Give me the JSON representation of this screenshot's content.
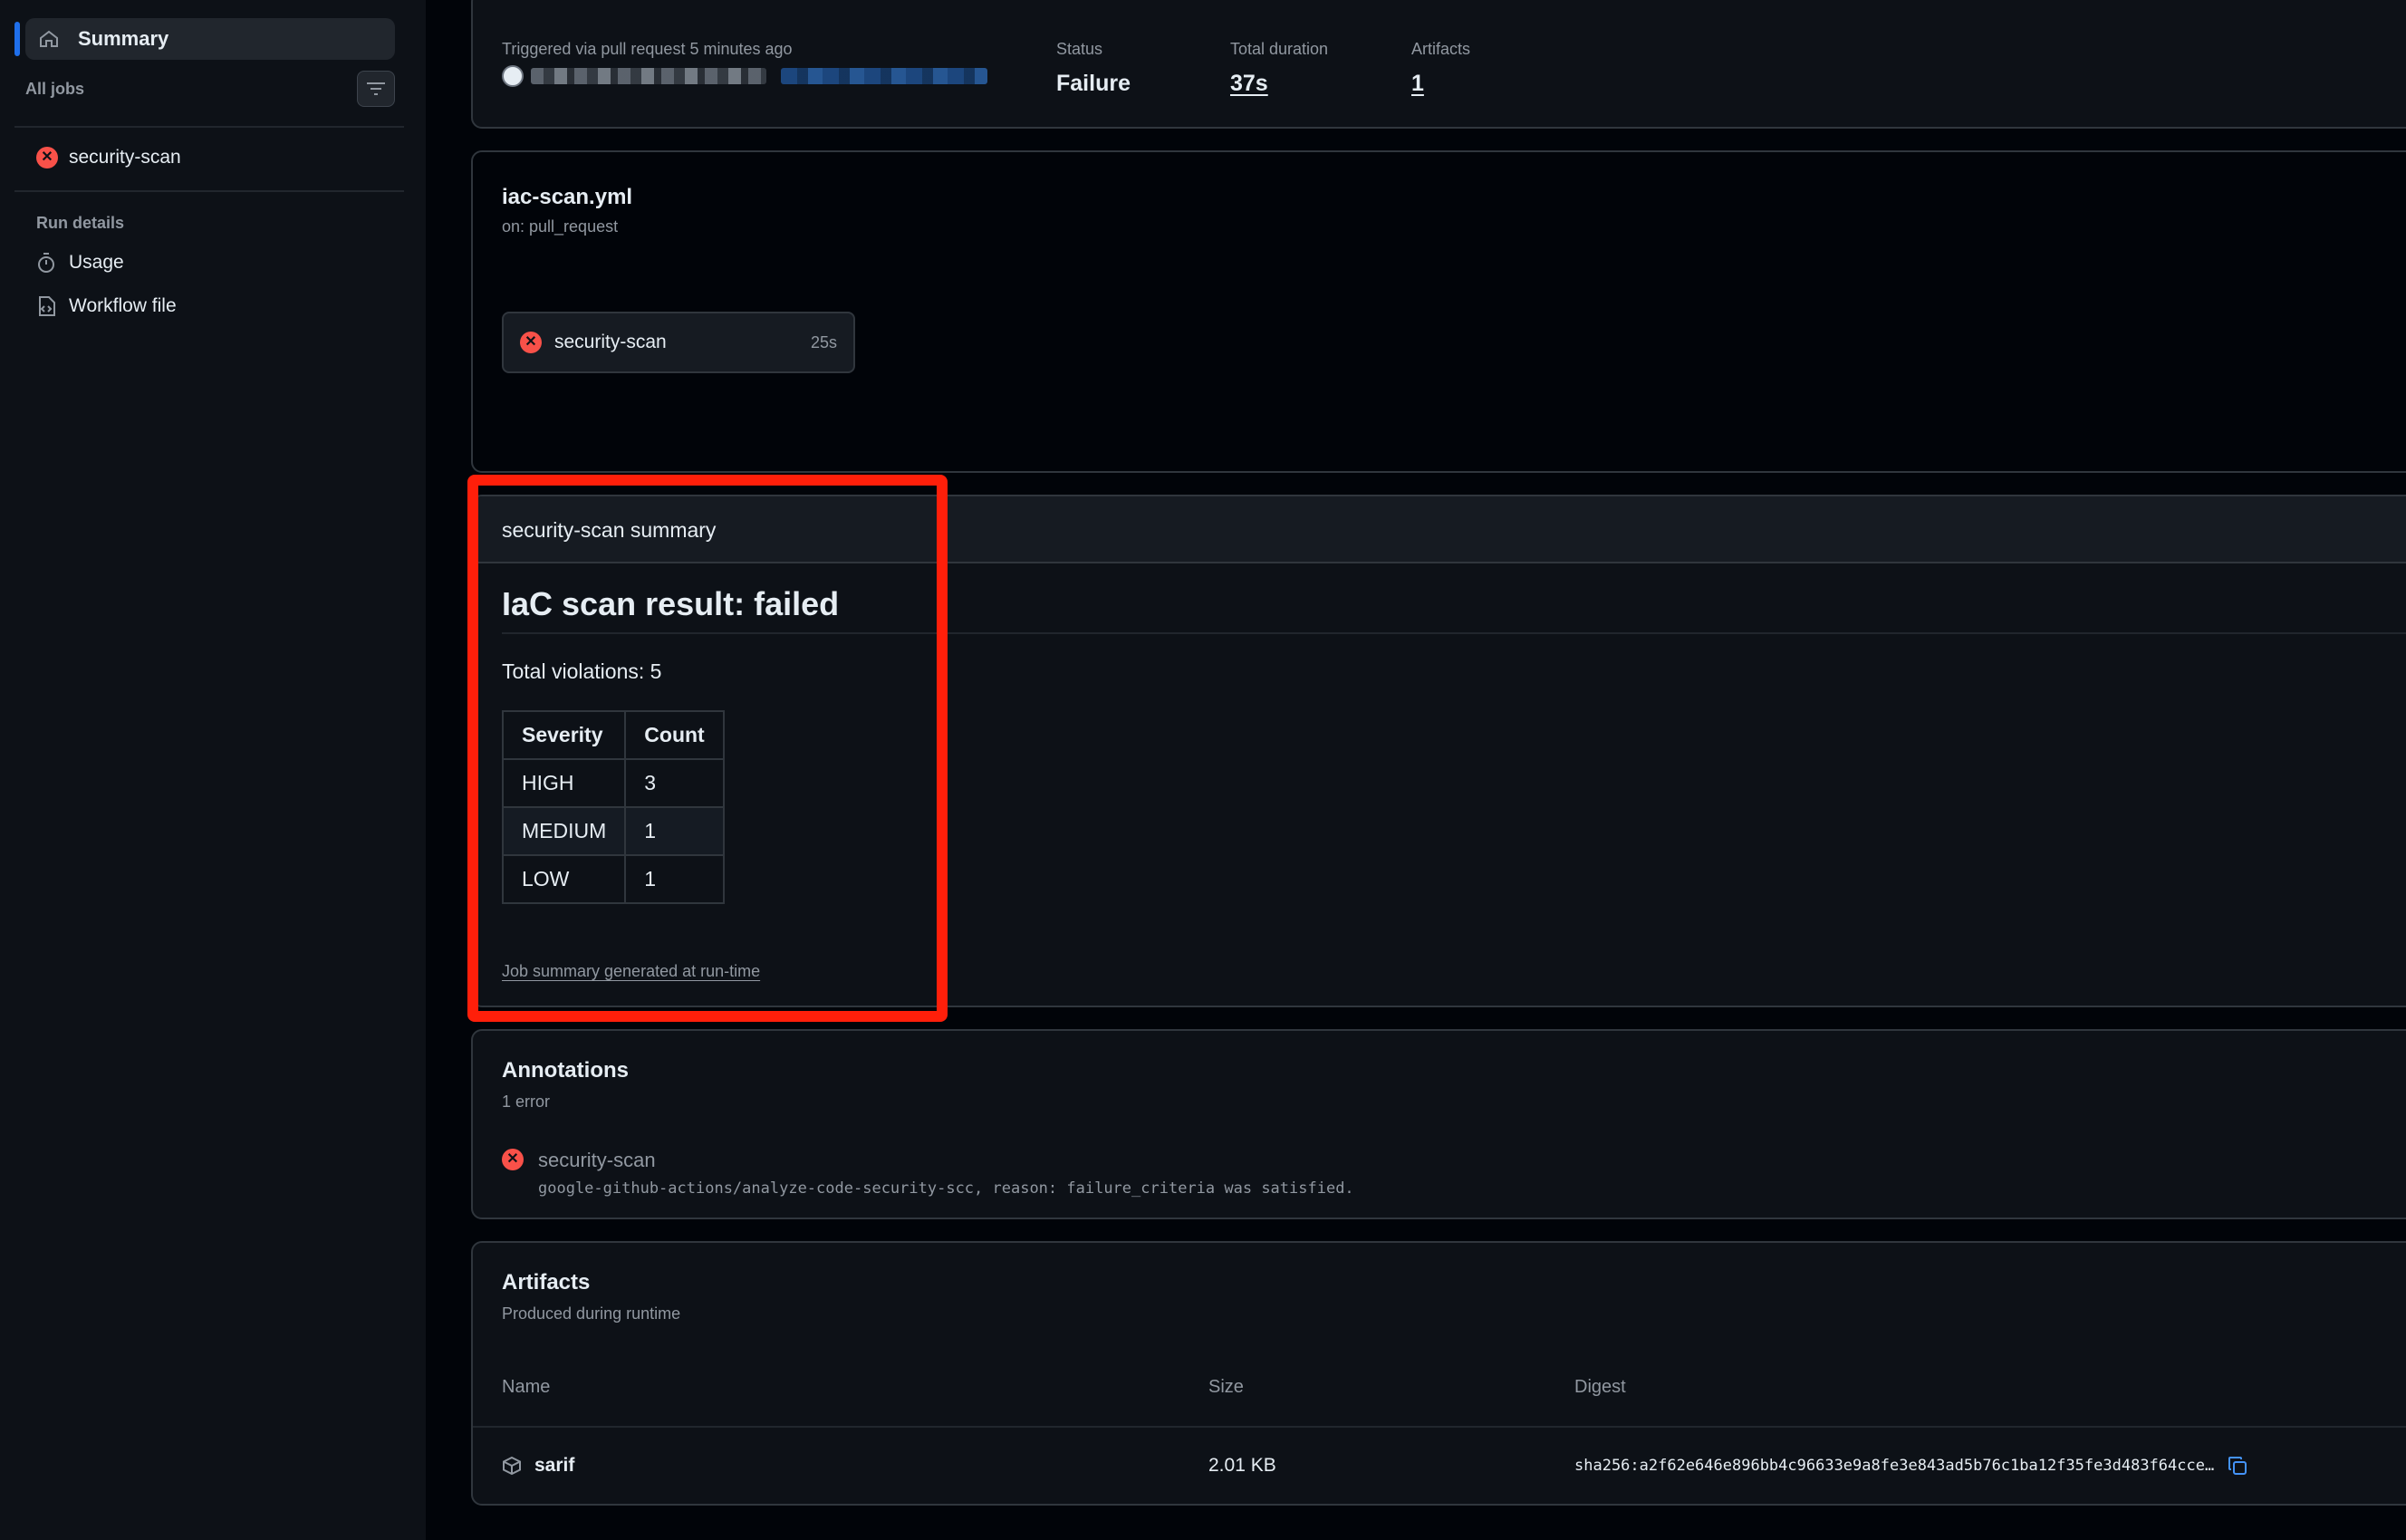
{
  "sidebar": {
    "summary_label": "Summary",
    "all_jobs_label": "All jobs",
    "jobs": [
      {
        "name": "security-scan",
        "status": "failure"
      }
    ],
    "run_details_label": "Run details",
    "links": [
      {
        "label": "Usage",
        "icon": "stopwatch-icon"
      },
      {
        "label": "Workflow file",
        "icon": "file-code-icon"
      }
    ]
  },
  "trigger": {
    "label": "Triggered via pull request 5 minutes ago",
    "status_label": "Status",
    "status_value": "Failure",
    "duration_label": "Total duration",
    "duration_value": "37s",
    "artifacts_label": "Artifacts",
    "artifacts_value": "1"
  },
  "workflow": {
    "file": "iac-scan.yml",
    "event": "on: pull_request",
    "job_name": "security-scan",
    "job_duration": "25s"
  },
  "job_summary": {
    "header": "security-scan summary",
    "heading": "IaC scan result: failed",
    "total_text": "Total violations: 5",
    "table": {
      "columns": [
        "Severity",
        "Count"
      ],
      "rows": [
        [
          "HIGH",
          "3"
        ],
        [
          "MEDIUM",
          "1"
        ],
        [
          "LOW",
          "1"
        ]
      ]
    },
    "footer": "Job summary generated at run-time"
  },
  "annotations": {
    "title": "Annotations",
    "count_text": "1 error",
    "items": [
      {
        "job": "security-scan",
        "message": "google-github-actions/analyze-code-security-scc, reason: failure_criteria was satisfied."
      }
    ]
  },
  "artifacts": {
    "title": "Artifacts",
    "subtitle": "Produced during runtime",
    "columns": [
      "Name",
      "Size",
      "Digest"
    ],
    "rows": [
      {
        "name": "sarif",
        "size": "2.01 KB",
        "digest": "sha256:a2f62e646e896bb4c96633e9a8fe3e843ad5b76c1ba12f35fe3d483f64cce…"
      }
    ]
  },
  "colors": {
    "accent": "#1f6feb",
    "failure": "#f85149",
    "highlight": "#ff1f0a"
  }
}
